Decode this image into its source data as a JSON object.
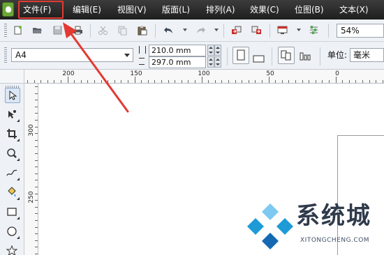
{
  "menu": {
    "items": [
      {
        "label": "文件(F)"
      },
      {
        "label": "编辑(E)"
      },
      {
        "label": "视图(V)"
      },
      {
        "label": "版面(L)"
      },
      {
        "label": "排列(A)"
      },
      {
        "label": "效果(C)"
      },
      {
        "label": "位图(B)"
      },
      {
        "label": "文本(X)"
      }
    ],
    "highlighted": "文件(F)"
  },
  "toolbar": {
    "icons": [
      "new-icon",
      "open-icon",
      "save-icon",
      "print-icon",
      "cut-icon",
      "copy-icon",
      "paste-icon",
      "undo-icon",
      "redo-icon",
      "import-icon",
      "export-icon",
      "application-launcher-icon",
      "options-icon"
    ],
    "zoom": "54%"
  },
  "property_bar": {
    "paper_size": "A4",
    "width": "210.0 mm",
    "height": "297.0 mm",
    "orientation_icons": [
      "portrait-icon",
      "landscape-icon"
    ],
    "page_layout_icons": [
      "all-pages-icon",
      "current-page-icon"
    ],
    "unit_label": "单位:",
    "unit_value": "毫米"
  },
  "rulers": {
    "horizontal_labels": [
      "200",
      "150",
      "100",
      "50",
      "0"
    ],
    "vertical_labels": [
      "300",
      "250"
    ]
  },
  "toolbox": {
    "tools": [
      "pick-tool-icon",
      "shape-tool-icon",
      "crop-tool-icon",
      "zoom-tool-icon",
      "freehand-tool-icon",
      "smart-fill-tool-icon",
      "rectangle-tool-icon",
      "ellipse-tool-icon",
      "polygon-tool-icon"
    ]
  },
  "annotation": {
    "color": "#e23a32",
    "target": "文件(F)"
  },
  "watermark": {
    "title": "系统城",
    "domain": "XITONGCHENG.COM"
  },
  "colors": {
    "menubar": "#2a2a2a",
    "toolbar_bg": "#eef1f5",
    "annotation": "#e23a32",
    "watermark_blue": "#1e9bd7"
  }
}
